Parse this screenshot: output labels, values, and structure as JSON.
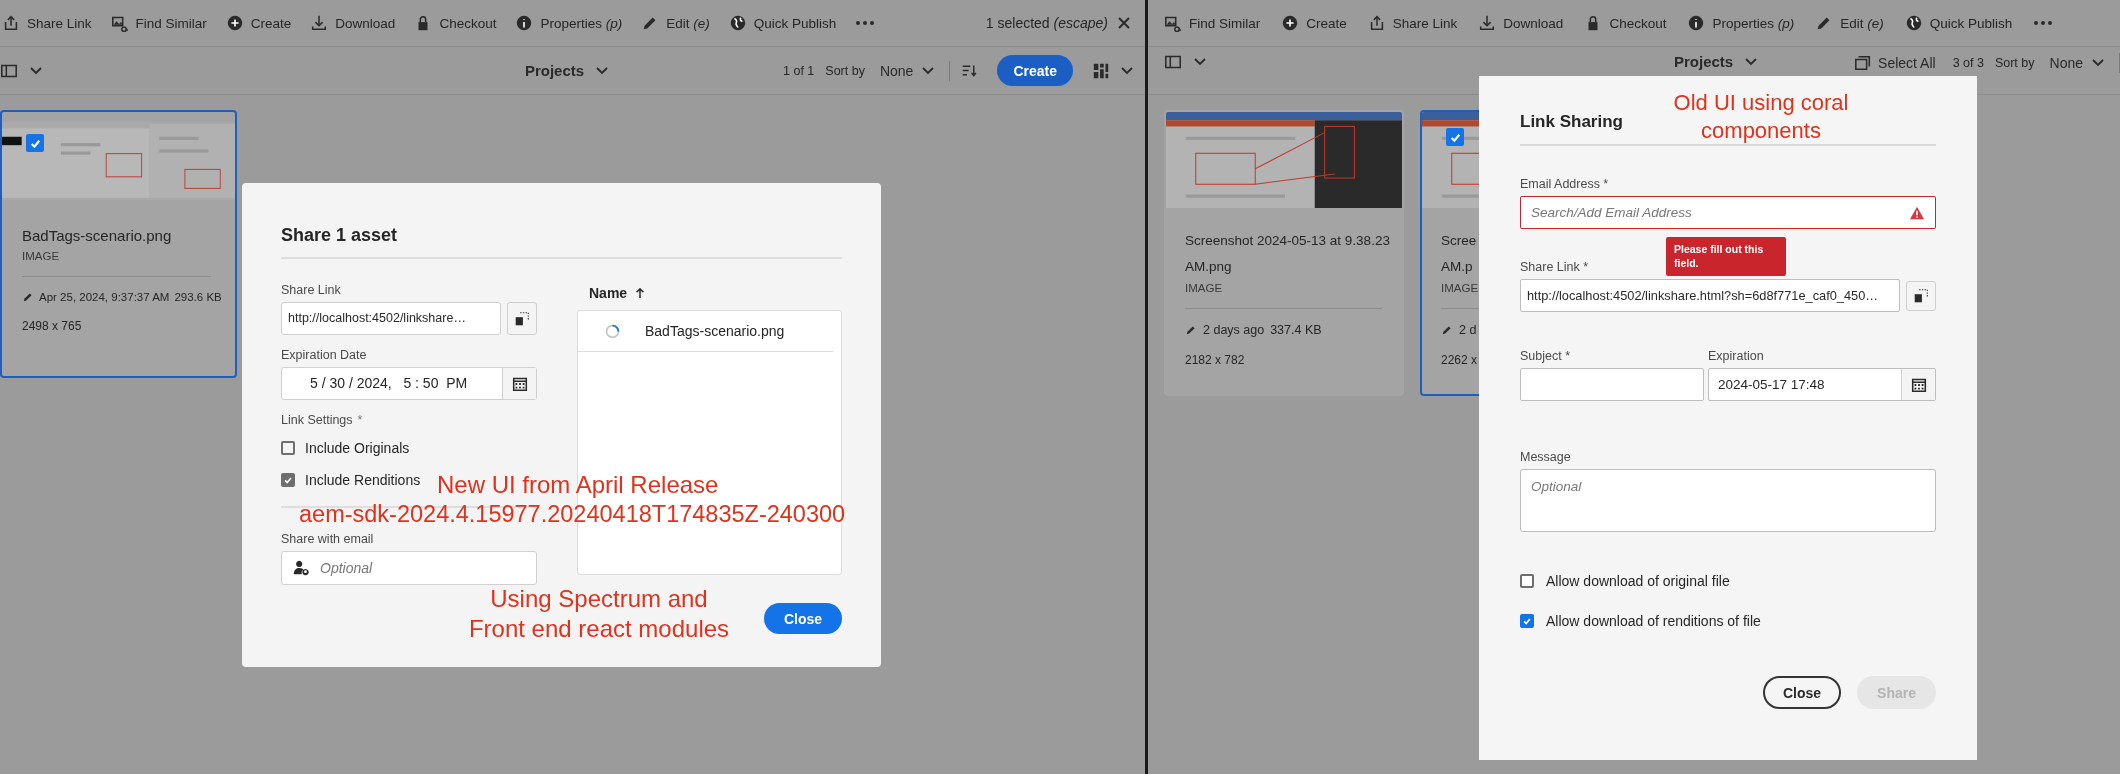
{
  "left_window": {
    "toolbar": {
      "actions": [
        {
          "kind": "share",
          "label": "Share Link"
        },
        {
          "kind": "find",
          "label": "Find Similar"
        },
        {
          "kind": "create",
          "label": "Create"
        },
        {
          "kind": "download",
          "label": "Download"
        },
        {
          "kind": "checkout",
          "label": "Checkout"
        },
        {
          "kind": "properties",
          "label": "Properties *(p)*"
        },
        {
          "kind": "edit",
          "label": "Edit *(e)*"
        },
        {
          "kind": "publish",
          "label": "Quick Publish"
        }
      ],
      "selection_status": "1 selected *(escape)*"
    },
    "header": {
      "title": "Projects",
      "count": "1 of 1",
      "sort_label": "Sort by",
      "sort_value": "None",
      "create_button": "Create"
    },
    "cards": [
      {
        "name": "BadTags-scenario.png",
        "type": "IMAGE",
        "modified": "Apr 25, 2024, 9:37:37 AM",
        "size": "293.6 KB",
        "dimensions": "2498 x 765",
        "selected": true,
        "checked": true
      }
    ],
    "dialog": {
      "title": "Share 1 asset",
      "share_link": {
        "label": "Share Link",
        "value": "http://localhost:4502/linkshare…"
      },
      "expiration": {
        "label": "Expiration Date",
        "value": "5 / 30 / 2024,   5 : 50  PM"
      },
      "link_settings": {
        "label": "Link Settings",
        "required_mark": "*",
        "options": [
          {
            "label": "Include Originals",
            "checked": false
          },
          {
            "label": "Include Renditions",
            "checked": true
          }
        ]
      },
      "email": {
        "label": "Share with email",
        "placeholder": "Optional"
      },
      "list": {
        "column": "Name",
        "rows": [
          {
            "name": "BadTags-scenario.png"
          }
        ]
      },
      "close_button": "Close"
    }
  },
  "right_window": {
    "toolbar": {
      "actions": [
        {
          "kind": "find",
          "label": "Find Similar"
        },
        {
          "kind": "create",
          "label": "Create"
        },
        {
          "kind": "share",
          "label": "Share Link"
        },
        {
          "kind": "download",
          "label": "Download"
        },
        {
          "kind": "checkout",
          "label": "Checkout"
        },
        {
          "kind": "properties",
          "label": "Properties *(p)*"
        },
        {
          "kind": "edit",
          "label": "Edit *(e)*"
        },
        {
          "kind": "publish",
          "label": "Quick Publish"
        }
      ]
    },
    "header": {
      "title": "Projects",
      "select_all": "Select All",
      "count": "3 of 3",
      "sort_label": "Sort by",
      "sort_value": "None"
    },
    "cards": [
      {
        "name": "Screenshot 2024-05-13 at 9.38.23 AM.png",
        "type": "IMAGE",
        "modified": "2 days ago",
        "size": "337.4 KB",
        "dimensions": "2182 x 782",
        "selected": false,
        "checked": false
      },
      {
        "name": "Scree",
        "name_2": "AM.p",
        "type": "IMAGE",
        "modified": "2 d",
        "dimensions": "2262 x",
        "selected": true,
        "checked": true
      }
    ],
    "dialog": {
      "title": "Link Sharing",
      "email": {
        "label": "Email Address *",
        "placeholder": "Search/Add Email Address",
        "invalid": true,
        "error": "Please fill out this field."
      },
      "share_link": {
        "label": "Share Link *",
        "value": "http://localhost:4502/linkshare.html?sh=6d8f771e_caf0_450…"
      },
      "subject": {
        "label": "Subject *"
      },
      "expiration": {
        "label": "Expiration",
        "value": "2024-05-17 17:48"
      },
      "message": {
        "label": "Message",
        "placeholder": "Optional"
      },
      "options": [
        {
          "label": "Allow download of original file",
          "checked": false
        },
        {
          "label": "Allow download of renditions of file",
          "checked": true
        }
      ],
      "buttons": [
        {
          "label": "Close",
          "disabled": false
        },
        {
          "label": "Share",
          "disabled": true
        }
      ]
    }
  },
  "annotations": [
    {
      "lines": [
        "New UI from April Release"
      ]
    },
    {
      "lines": [
        "aem-sdk-2024.4.15977.20240418T174835Z-240300"
      ]
    },
    {
      "lines": [
        "Using Spectrum and",
        "Front end react modules"
      ]
    },
    {
      "lines": [
        "Old UI using coral",
        "components"
      ]
    }
  ]
}
